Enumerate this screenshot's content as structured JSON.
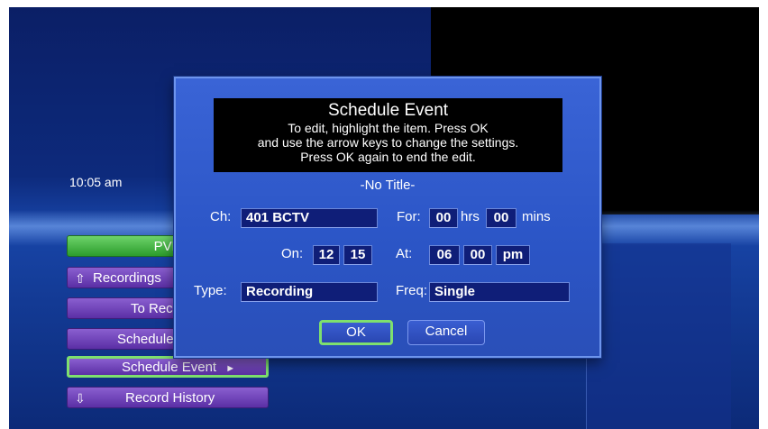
{
  "clock": "10:05 am",
  "menu": {
    "items": [
      {
        "label": "PVR",
        "icon": "",
        "name": "menu-item-pvr"
      },
      {
        "label": "Recordings",
        "icon": "⇧",
        "name": "menu-item-recordings"
      },
      {
        "label": "To Record",
        "icon": "",
        "name": "menu-item-to-record"
      },
      {
        "label": "Schedule Priority",
        "icon": "",
        "name": "menu-item-schedule-priority"
      },
      {
        "label": "Schedule Event",
        "icon": "",
        "name": "menu-item-schedule-event",
        "arrow": "►"
      },
      {
        "label": "Record History",
        "icon": "⇩",
        "name": "menu-item-record-history"
      }
    ]
  },
  "dialog": {
    "title": "Schedule Event",
    "instructions": [
      "To edit, highlight the item. Press OK",
      "and use the arrow keys to change the settings.",
      "Press OK again to end the edit."
    ],
    "program_title": "-No Title-",
    "channel": {
      "label": "Ch:",
      "value": "401 BCTV"
    },
    "duration": {
      "label": "For:",
      "hours": "00",
      "hours_unit": "hrs",
      "minutes": "00",
      "minutes_unit": "mins"
    },
    "date": {
      "label": "On:",
      "month": "12",
      "day": "15"
    },
    "time": {
      "label": "At:",
      "hour": "06",
      "minute": "00",
      "ampm": "pm"
    },
    "type": {
      "label": "Type:",
      "value": "Recording"
    },
    "frequency": {
      "label": "Freq:",
      "value": "Single"
    },
    "ok_label": "OK",
    "cancel_label": "Cancel"
  },
  "colors": {
    "menu_purple": "#5b2fa5",
    "menu_green": "#2c9c2c",
    "highlight_green": "#7ee06e",
    "dialog_blue": "#2b55c6",
    "field_navy": "#0f1e78"
  }
}
